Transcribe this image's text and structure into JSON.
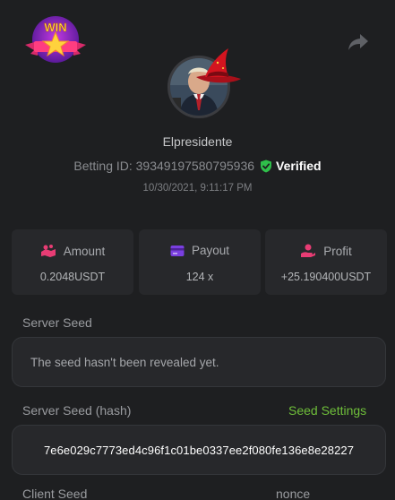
{
  "user": {
    "name": "Elpresidente",
    "betting_id_label": "Betting ID: 39349197580795936",
    "verified_label": "Verified",
    "timestamp": "10/30/2021, 9:11:17 PM"
  },
  "badge": {
    "text": "WIN"
  },
  "stats": [
    {
      "icon": "amount-icon",
      "label": "Amount",
      "value": "0.2048USDT"
    },
    {
      "icon": "payout-icon",
      "label": "Payout",
      "value": "124 x"
    },
    {
      "icon": "profit-icon",
      "label": "Profit",
      "value": "+25.190400USDT"
    }
  ],
  "server_seed": {
    "label": "Server Seed",
    "value": "The seed hasn't been revealed yet."
  },
  "server_seed_hash": {
    "label": "Server Seed (hash)",
    "settings_link": "Seed Settings",
    "value": "7e6e029c7773ed4c96f1c01be0337ee2f080fe136e8e28227"
  },
  "client_seed": {
    "label": "Client Seed",
    "nonce_label": "nonce"
  },
  "colors": {
    "accent_green": "#6fbf3a",
    "stat_icon_pink": "#e83c74",
    "stat_icon_purple": "#7a3fe0"
  }
}
